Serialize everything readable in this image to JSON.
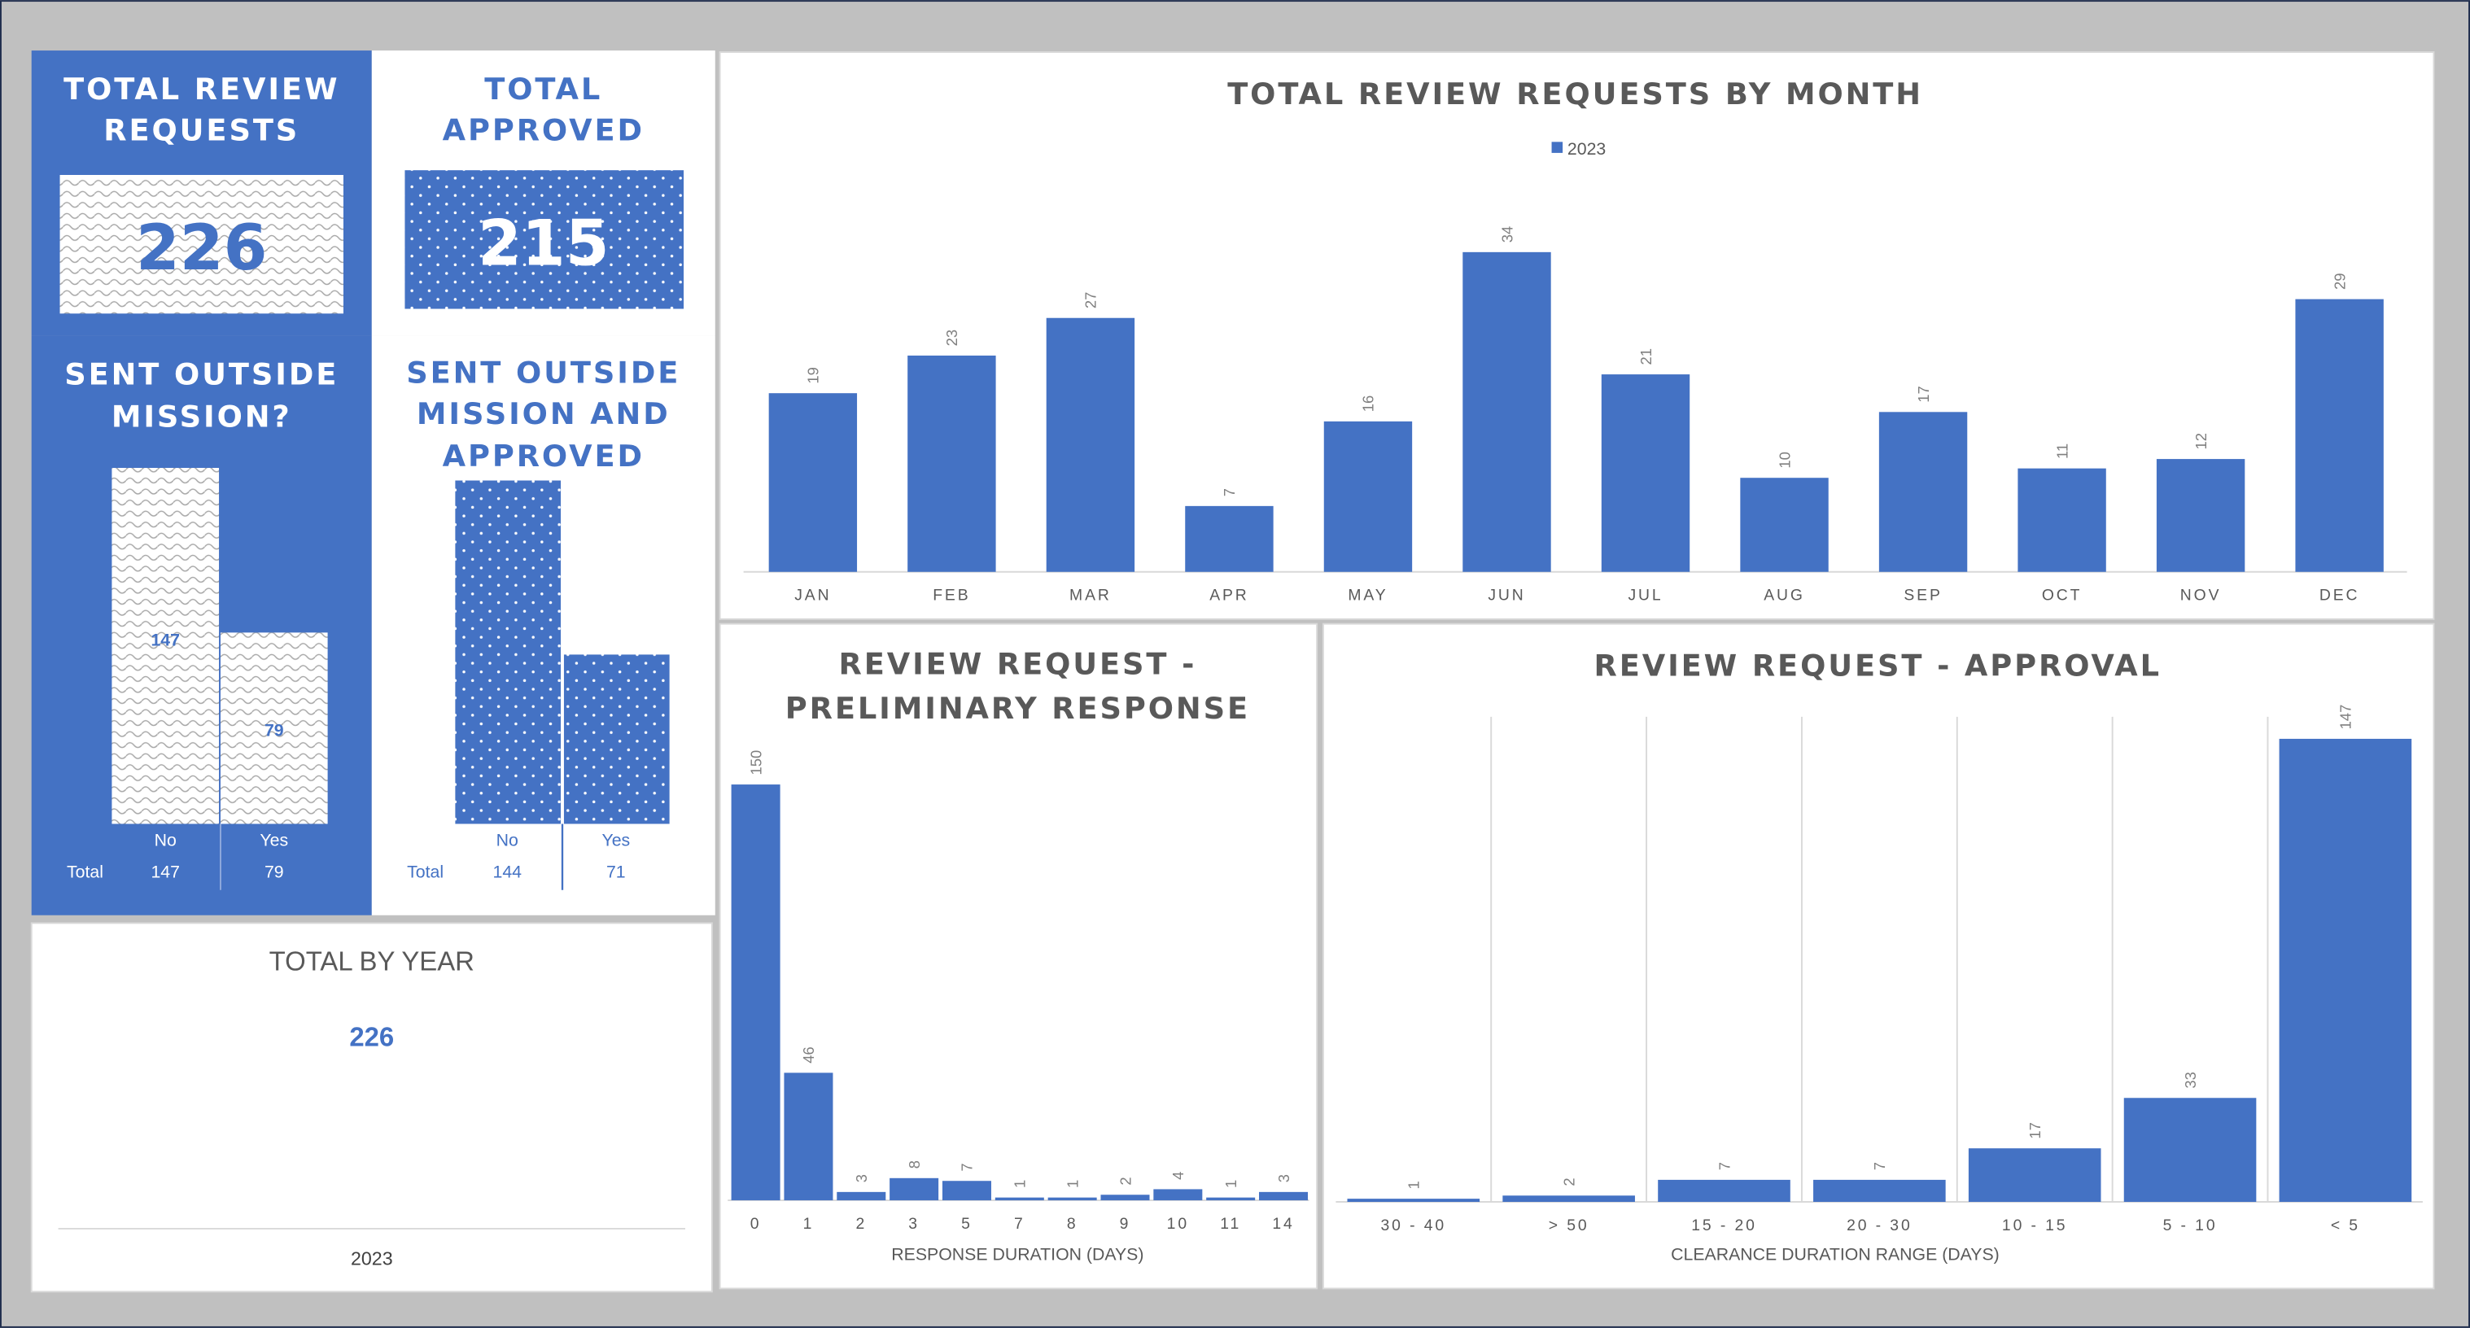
{
  "colors": {
    "accent": "#4472c4",
    "background": "#c0c0c0",
    "title_text": "#595959"
  },
  "kpis": {
    "total_review_requests": {
      "title_line1": "TOTAL REVIEW",
      "title_line2": "REQUESTS",
      "value": "226"
    },
    "total_approved": {
      "title_line1": "TOTAL",
      "title_line2": "APPROVED",
      "value": "215"
    }
  },
  "sent_outside": {
    "title_line1": "SENT OUTSIDE",
    "title_line2": "MISSION?",
    "row_label": "Total",
    "categories": [
      "No",
      "Yes"
    ],
    "values": [
      147,
      79
    ],
    "value_labels": [
      "147",
      "79"
    ]
  },
  "sent_outside_approved": {
    "title_line1": "SENT OUTSIDE",
    "title_line2": "MISSION AND",
    "title_line3": "APPROVED",
    "row_label": "Total",
    "categories": [
      "No",
      "Yes"
    ],
    "values": [
      144,
      71
    ],
    "value_labels": [
      "144",
      "71"
    ]
  },
  "total_by_year": {
    "title": "TOTAL BY YEAR",
    "value": "226",
    "year": "2023"
  },
  "chart_data": [
    {
      "type": "bar",
      "title": "TOTAL REVIEW REQUESTS BY MONTH",
      "legend": "top",
      "categories": [
        "JAN",
        "FEB",
        "MAR",
        "APR",
        "MAY",
        "JUN",
        "JUL",
        "AUG",
        "SEP",
        "OCT",
        "NOV",
        "DEC"
      ],
      "series": [
        {
          "name": "2023",
          "values": [
            19,
            23,
            27,
            7,
            16,
            34,
            21,
            10,
            17,
            11,
            12,
            29
          ]
        }
      ],
      "xlabel": "",
      "ylabel": "",
      "ylim": [
        0,
        34
      ],
      "grid": false
    },
    {
      "type": "bar",
      "title_line1": "REVIEW REQUEST -",
      "title_line2": "PRELIMINARY RESPONSE",
      "categories": [
        "0",
        "1",
        "2",
        "3",
        "5",
        "7",
        "8",
        "9",
        "10",
        "11",
        "14"
      ],
      "values": [
        150,
        46,
        3,
        8,
        7,
        1,
        1,
        2,
        4,
        1,
        3
      ],
      "xlabel": "RESPONSE DURATION (DAYS)",
      "ylabel": "",
      "ylim": [
        0,
        150
      ],
      "grid": false
    },
    {
      "type": "bar",
      "title": "REVIEW REQUEST - APPROVAL",
      "categories": [
        "30 - 40",
        "> 50",
        "15 - 20",
        "20 - 30",
        "10 - 15",
        "5 - 10",
        "< 5"
      ],
      "values": [
        1,
        2,
        7,
        7,
        17,
        33,
        147
      ],
      "xlabel": "CLEARANCE DURATION RANGE (DAYS)",
      "ylabel": "",
      "ylim": [
        0,
        147
      ],
      "grid": "vertical"
    }
  ]
}
